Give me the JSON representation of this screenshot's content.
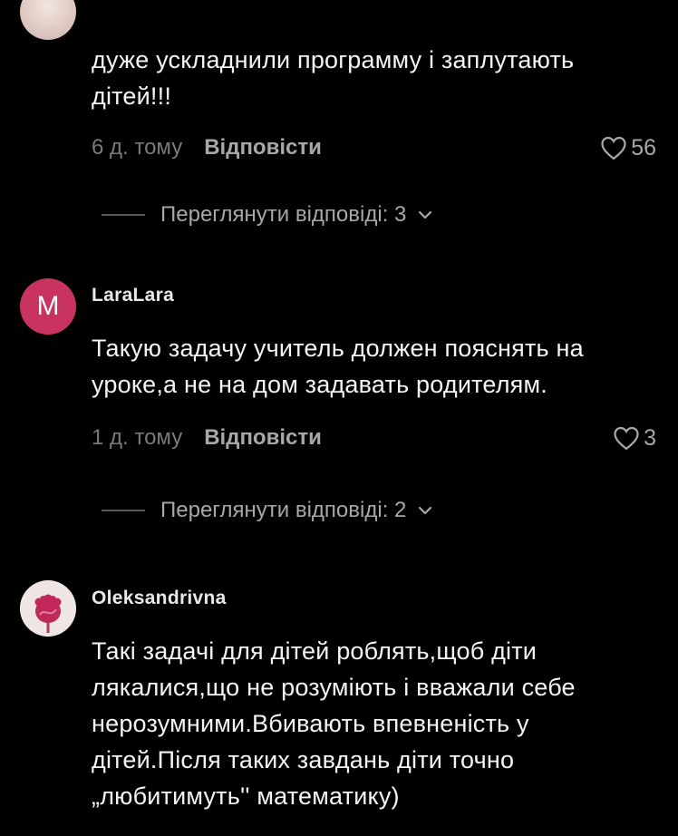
{
  "comments": [
    {
      "text_lines": [
        "дуже ускладнили программу і заплутають",
        "дітей!!!"
      ],
      "time": "6 д. тому",
      "reply": "Відповісти",
      "likes": "56",
      "view_replies": "Переглянути відповіді: 3"
    },
    {
      "avatar_letter": "M",
      "username": "LaraLara",
      "text_lines": [
        "Такую задачу учитель должен пояснять на",
        "уроке,а не на дом задавать родителям."
      ],
      "time": "1 д. тому",
      "reply": "Відповісти",
      "likes": "3",
      "view_replies": "Переглянути відповіді: 2"
    },
    {
      "username": "Oleksandrivna",
      "text_lines": [
        "Такі задачі для дітей роблять,щоб діти",
        "лякалися,що не розуміють і вважали себе",
        "нерозумними.Вбивають впевненість у",
        "дітей.Після таких завдань діти точно",
        "„любитимуть'' математику)"
      ]
    }
  ],
  "colors": {
    "avatar_m": "#c8345f",
    "muted": "#a8a8a8",
    "time": "#7a7a7a"
  },
  "icons": {
    "like": "heart-outline-icon",
    "expand": "chevron-down-icon"
  }
}
